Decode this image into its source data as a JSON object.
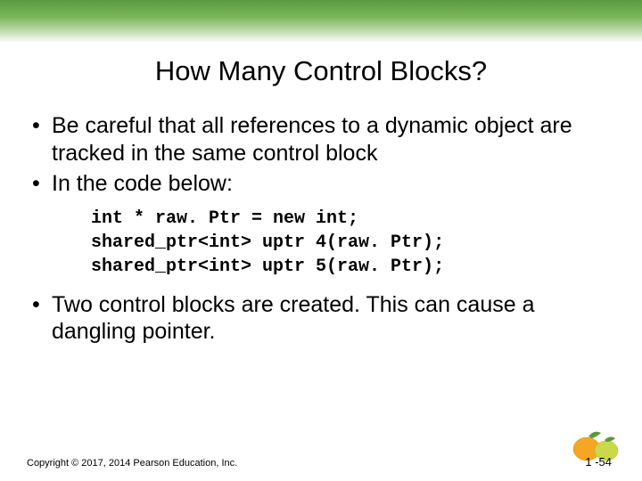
{
  "title": "How Many Control Blocks?",
  "bullets_top": [
    "Be careful that all references to a dynamic object are tracked in the same control block",
    "In the code below:"
  ],
  "code_lines": [
    "int * raw. Ptr = new int;",
    "shared_ptr<int> uptr 4(raw. Ptr);",
    "shared_ptr<int> uptr 5(raw. Ptr);"
  ],
  "bullets_bottom": [
    "Two control blocks are created.  This can cause a dangling pointer."
  ],
  "copyright": "Copyright © 2017, 2014 Pearson Education, Inc.",
  "page_number": "1 -54"
}
